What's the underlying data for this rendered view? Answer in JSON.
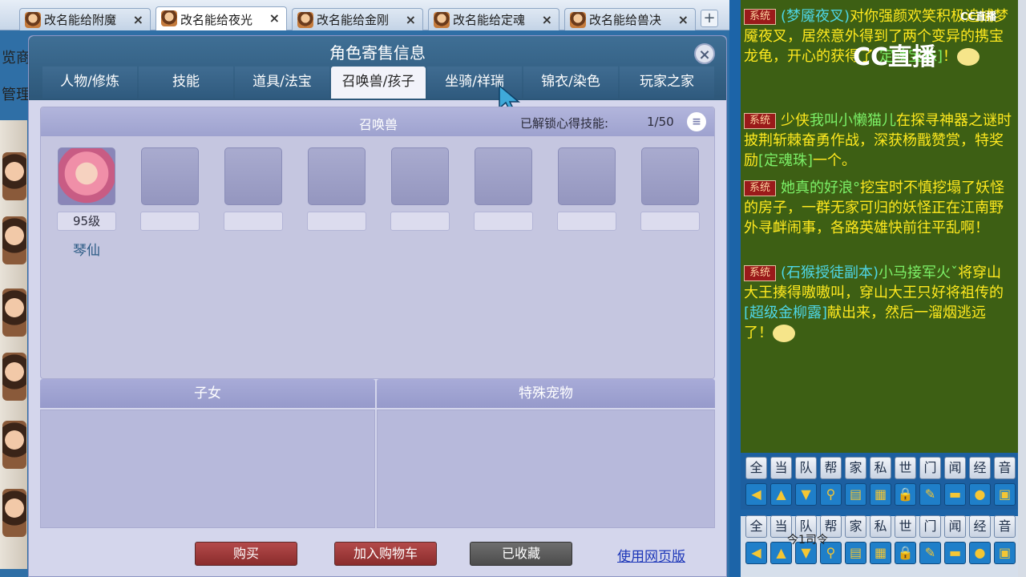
{
  "browser_tabs": [
    {
      "label": "改名能给附魔",
      "active": false
    },
    {
      "label": "改名能给夜光",
      "active": true
    },
    {
      "label": "改名能给金刚",
      "active": false
    },
    {
      "label": "改名能给定魂",
      "active": false
    },
    {
      "label": "改名能给兽决",
      "active": false
    }
  ],
  "new_tab_symbol": "+",
  "tab_close_symbol": "×",
  "side_text": [
    "览商",
    "管理"
  ],
  "dialog": {
    "title": "角色寄售信息",
    "close_symbol": "×",
    "tabs": [
      "人物/修炼",
      "技能",
      "道具/法宝",
      "召唤兽/孩子",
      "坐骑/祥瑞",
      "锦衣/染色",
      "玩家之家"
    ],
    "active_tab_index": 3
  },
  "summon_panel": {
    "title": "召唤兽",
    "skill_label": "已解锁心得技能:",
    "skill_count": "1/50",
    "pets": [
      {
        "level": "95级",
        "name": "琴仙"
      }
    ],
    "empty_slot_count": 7
  },
  "sections": {
    "children_title": "子女",
    "special_pet_title": "特殊宠物"
  },
  "actions": {
    "buy": "购买",
    "add_cart": "加入购物车",
    "favorited": "已收藏",
    "web_version": "使用网页版"
  },
  "chat": {
    "system_tag": "系统",
    "messages": [
      {
        "parts": [
          {
            "t": "(梦魇夜叉)",
            "c": "cy"
          },
          {
            "t": "对你强颜欢笑积极追捕梦魇夜叉，居然意外得到了两个变异的携宝龙龟，开心的获得了",
            "c": ""
          },
          {
            "t": "[定魂宝珠]",
            "c": "gr"
          },
          {
            "t": "！",
            "c": ""
          }
        ]
      },
      {
        "parts": [
          {
            "t": "少侠",
            "c": ""
          },
          {
            "t": "我叫小懒猫儿",
            "c": "gr"
          },
          {
            "t": "在探寻神器之谜时披荆斩棘奋勇作战，深获杨戬赞赏，特奖励",
            "c": ""
          },
          {
            "t": "[定魂珠]",
            "c": "gr"
          },
          {
            "t": "一个。",
            "c": ""
          }
        ]
      },
      {
        "parts": [
          {
            "t": "她真的好浪°",
            "c": "gr"
          },
          {
            "t": "挖宝时不慎挖塌了妖怪的房子，一群无家可归的妖怪正在江南野外寻衅闹事，各路英雄快前往平乱啊！",
            "c": ""
          }
        ]
      },
      {
        "parts": [
          {
            "t": "(石猴授徒副本)",
            "c": "cy"
          },
          {
            "t": "小马接军火ˇ",
            "c": "gr"
          },
          {
            "t": "将穿山大王揍得嗷嗷叫，穿山大王只好将祖传的",
            "c": ""
          },
          {
            "t": "[超级金柳露]",
            "c": "cy"
          },
          {
            "t": "献出来，然后一溜烟逃远了！",
            "c": ""
          }
        ]
      }
    ],
    "watermark": "CC直播",
    "watermark_small": "CC直播"
  },
  "channels": [
    "全",
    "当",
    "队",
    "帮",
    "家",
    "私",
    "世",
    "门",
    "闻",
    "经",
    "音"
  ],
  "tool_icons": [
    "arrow-left-icon",
    "arrow-up-icon",
    "arrow-down-icon",
    "magnifier-icon",
    "note-icon",
    "grid-icon",
    "lock-icon",
    "brush-icon",
    "folder-icon",
    "speech-icon",
    "list-add-icon"
  ],
  "tool_glyphs": [
    "◀",
    "▲",
    "▼",
    "⚲",
    "▤",
    "▦",
    "🔒",
    "✎",
    "▬",
    "●",
    "▣"
  ],
  "lower_channels": [
    "全",
    "当",
    "队",
    "帮",
    "家",
    "私",
    "世",
    "门",
    "闻",
    "经",
    "音"
  ],
  "lower_label": "今1司令"
}
